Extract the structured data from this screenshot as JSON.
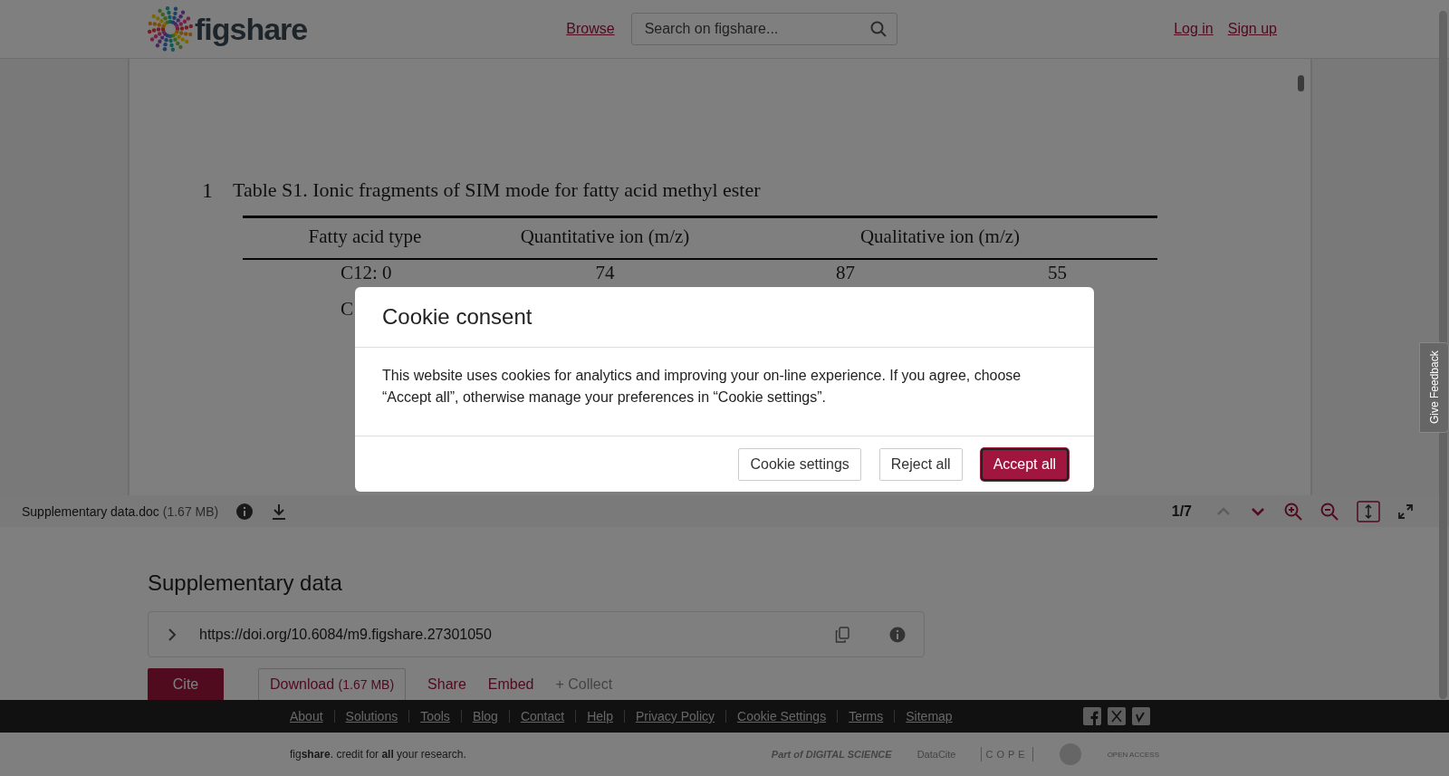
{
  "header": {
    "logo": "figshare",
    "nav": [
      {
        "label": "Browse"
      }
    ],
    "search": {
      "placeholder": "Search on figshare..."
    },
    "auth": [
      {
        "label": "Log in"
      },
      {
        "label": "Sign up"
      }
    ]
  },
  "document": {
    "line_number": "1",
    "caption": "Table S1. Ionic fragments of SIM mode for fatty acid methyl ester",
    "columns": [
      "Fatty acid type",
      "Quantitative ion (m/z)",
      "Qualitative ion (m/z)"
    ],
    "rows": [
      {
        "type": "C12: 0",
        "quantitative": "74",
        "qualitative": [
          "87",
          "55"
        ]
      },
      {
        "type": "C"
      }
    ]
  },
  "viewer_toolbar": {
    "file_name": "Supplementary data.doc",
    "file_size": "(1.67 MB)",
    "page": "1/7"
  },
  "item": {
    "title": "Supplementary data",
    "doi": "https://doi.org/10.6084/m9.figshare.27301050",
    "actions": [
      {
        "kind": "primary",
        "label": "Cite"
      },
      {
        "kind": "outline",
        "label": "Download",
        "extra": "(1.67 MB)"
      },
      {
        "kind": "link",
        "label": "Share"
      },
      {
        "kind": "link",
        "label": "Embed"
      },
      {
        "kind": "muted",
        "label": "+ Collect"
      }
    ]
  },
  "footer": {
    "links": [
      "About",
      "Solutions",
      "Tools",
      "Blog",
      "Contact",
      "Help",
      "Privacy Policy",
      "Cookie Settings",
      "Terms",
      "Sitemap"
    ],
    "tagline": "fig**share**. credit for **all** your research.",
    "partners": [
      {
        "kind": "digital-science",
        "label": "Part of DIGITAL SCIENCE"
      },
      {
        "kind": "datacite",
        "label": "DataCite"
      },
      {
        "kind": "cope",
        "label": "COPE"
      },
      {
        "kind": "badge"
      },
      {
        "kind": "open-access",
        "label": "OPEN ACCESS"
      }
    ]
  },
  "feedback_tab": "Give Feedback",
  "cookie_dialog": {
    "title": "Cookie consent",
    "body": "This website uses cookies for analytics and improving your on-line experience. If you agree, choose “Accept all”, otherwise manage your preferences in “Cookie settings”.",
    "buttons": [
      {
        "label": "Cookie settings",
        "selected": false
      },
      {
        "label": "Reject all",
        "selected": false
      },
      {
        "label": "Accept all",
        "selected": true
      }
    ]
  }
}
